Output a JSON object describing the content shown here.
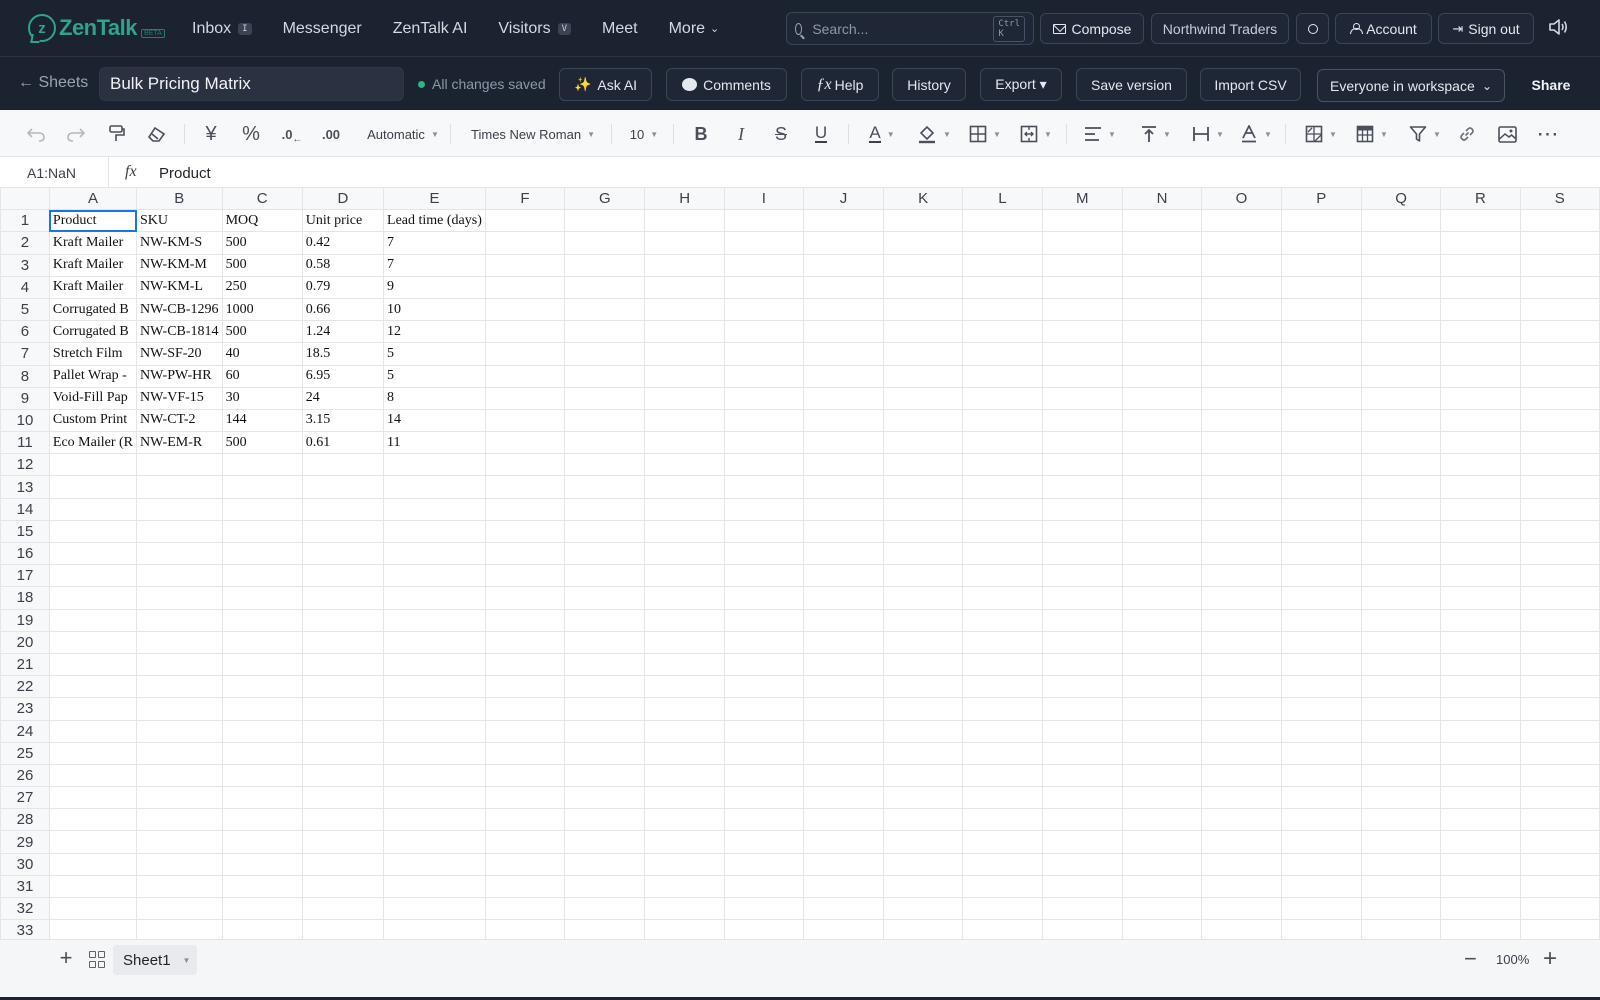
{
  "app": {
    "name": "ZenTalk",
    "badge": "BETA"
  },
  "nav": {
    "links": [
      {
        "label": "Inbox",
        "kbd": "I"
      },
      {
        "label": "Messenger"
      },
      {
        "label": "ZenTalk AI"
      },
      {
        "label": "Visitors",
        "kbd": "V"
      },
      {
        "label": "Meet"
      },
      {
        "label": "More"
      }
    ],
    "search_placeholder": "Search...",
    "search_kbd": "Ctrl K",
    "compose": "Compose",
    "org": "Northwind Traders",
    "account": "Account",
    "signout": "Sign out"
  },
  "docbar": {
    "back": "← Sheets",
    "title": "Bulk Pricing Matrix",
    "status": "All changes saved",
    "ask_ai": "Ask AI",
    "comments": "Comments",
    "help": "Help",
    "history": "History",
    "export": "Export ▾",
    "save_version": "Save version",
    "import_csv": "Import CSV",
    "visibility": "Everyone in workspace",
    "share": "Share"
  },
  "toolbar": {
    "currency": "¥",
    "percent": "%",
    "dec_less": ".0",
    "dec_more": ".00",
    "number_format": "Automatic",
    "font_family": "Times New Roman",
    "font_size": "10",
    "bold": "B",
    "italic": "I",
    "strike": "S",
    "underline": "U",
    "text_color": "A"
  },
  "formula": {
    "cell_ref": "A1:NaN",
    "fx": "fx",
    "value": "Product"
  },
  "sheet": {
    "columns": [
      "A",
      "B",
      "C",
      "D",
      "E",
      "F",
      "G",
      "H",
      "I",
      "J",
      "K",
      "L",
      "M",
      "N",
      "O",
      "P",
      "Q",
      "R",
      "S"
    ],
    "row_count": 33,
    "rows": [
      [
        "Product",
        "SKU",
        "MOQ",
        "Unit price",
        "Lead time (days)"
      ],
      [
        "Kraft Mailer",
        "NW-KM-S",
        "500",
        "0.42",
        "7"
      ],
      [
        "Kraft Mailer",
        "NW-KM-M",
        "500",
        "0.58",
        "7"
      ],
      [
        "Kraft Mailer",
        "NW-KM-L",
        "250",
        "0.79",
        "9"
      ],
      [
        "Corrugated B",
        "NW-CB-1296",
        "1000",
        "0.66",
        "10"
      ],
      [
        "Corrugated B",
        "NW-CB-1814",
        "500",
        "1.24",
        "12"
      ],
      [
        "Stretch Film",
        "NW-SF-20",
        "40",
        "18.5",
        "5"
      ],
      [
        "Pallet Wrap -",
        "NW-PW-HR",
        "60",
        "6.95",
        "5"
      ],
      [
        "Void-Fill Pap",
        "NW-VF-15",
        "30",
        "24",
        "8"
      ],
      [
        "Custom Print",
        "NW-CT-2",
        "144",
        "3.15",
        "14"
      ],
      [
        "Eco Mailer (R",
        "NW-EM-R",
        "500",
        "0.61",
        "11"
      ]
    ]
  },
  "footer": {
    "sheet_tab": "Sheet1",
    "zoom": "100%"
  },
  "colors": {
    "nav_bg": "#1b2230",
    "brand": "#2fa38c",
    "saved_dot": "#2fb380",
    "selection": "#1a73e8"
  }
}
